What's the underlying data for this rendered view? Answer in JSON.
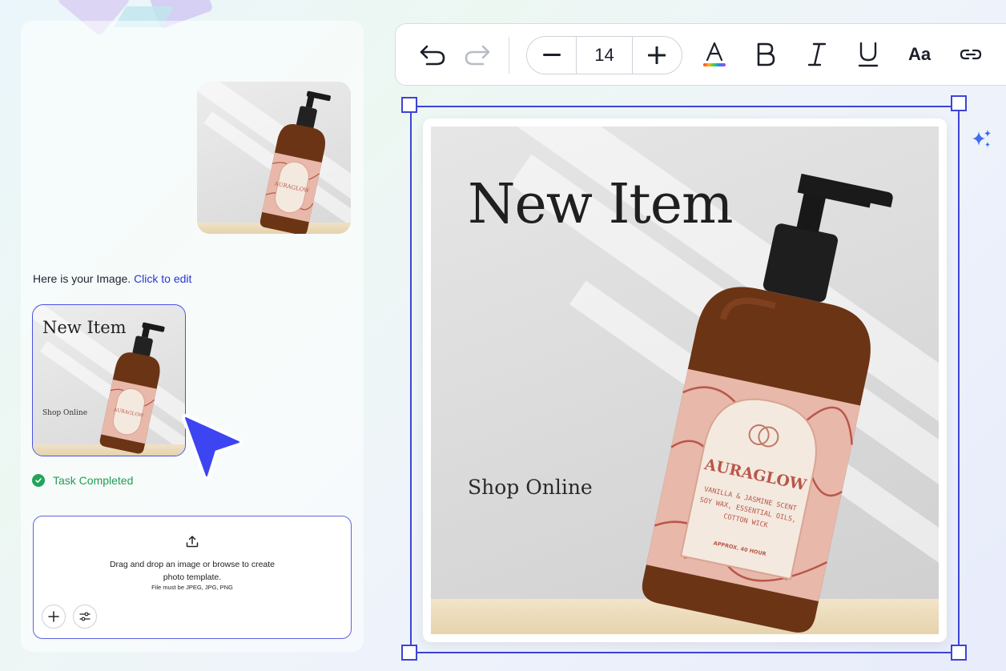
{
  "chat": {
    "message_text": "Here is your Image. ",
    "message_link": "Click to edit",
    "result_title": "New Item",
    "result_subtitle": "Shop Online",
    "status": "Task Completed"
  },
  "upload": {
    "line1": "Drag and drop an image or browse to create",
    "line2": "photo template.",
    "note": "File must be JPEG, JPG, PNG"
  },
  "product": {
    "brand": "AURAGLOW",
    "details": [
      "VANILLA & JASMINE SCENT",
      "SOY WAX, ESSENTIAL OILS,",
      "COTTON WICK"
    ],
    "footer": "APPROX. 40 HOUR"
  },
  "toolbar": {
    "font_size": "14",
    "style_glyph": "Aa",
    "icons": [
      "undo-icon",
      "redo-icon",
      "minus-icon",
      "plus-icon",
      "text-color-icon",
      "bold-icon",
      "italic-icon",
      "underline-icon",
      "font-style-icon",
      "link-icon"
    ]
  },
  "canvas": {
    "title": "New Item",
    "subtitle": "Shop Online"
  },
  "colors": {
    "accent": "#3d44d8",
    "success": "#22a55b",
    "link": "#2b34d8",
    "bottle_glass": "#6b3414",
    "label_pink": "#e8b8aa"
  }
}
